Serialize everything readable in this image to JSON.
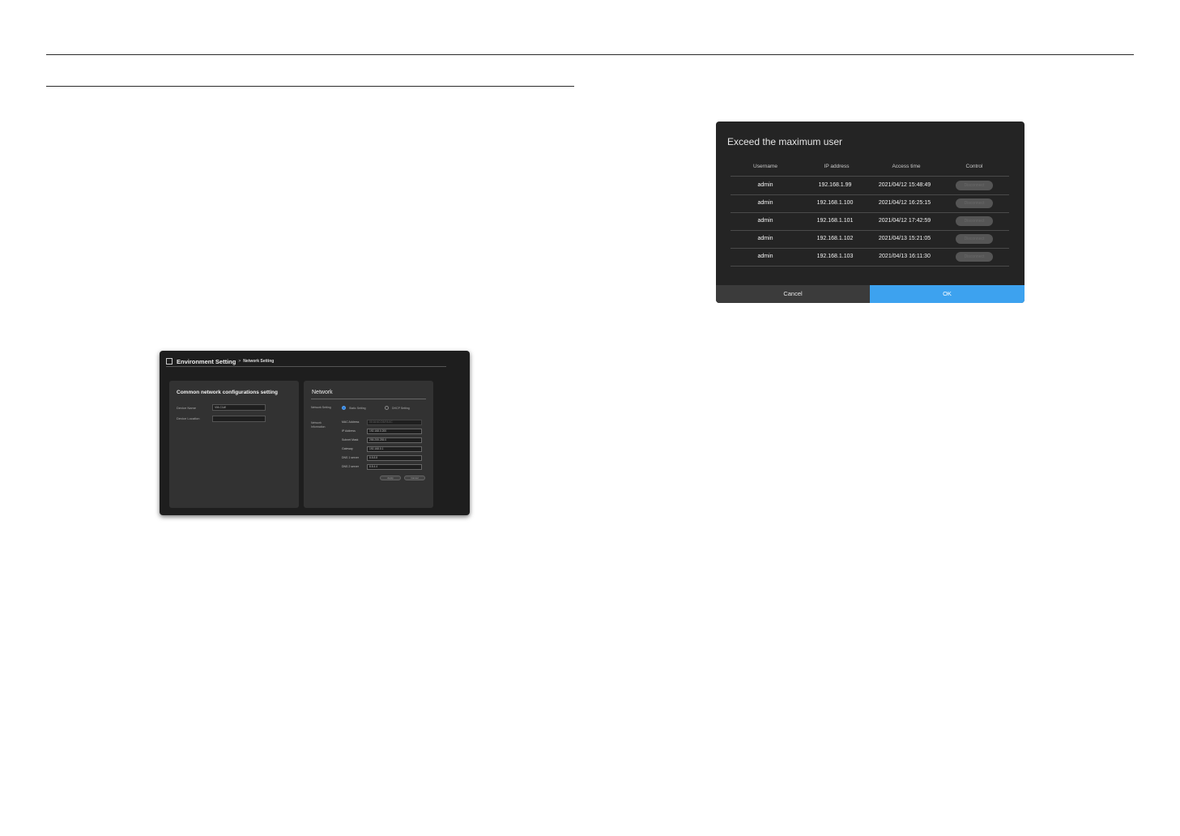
{
  "network_screenshot": {
    "title": "Environment Setting",
    "separator": ">",
    "subtitle": "Network Setting",
    "common": {
      "title": "Common network configurations setting",
      "device_name_label": "Device Name",
      "device_name_value": "VM-CLW",
      "device_location_label": "Device Location",
      "device_location_value": ""
    },
    "network": {
      "title": "Network",
      "network_setting_label": "Network Setting",
      "static_label": "Static Setting",
      "dhcp_label": "DHCP Setting",
      "network_info_label": "Network Information",
      "fields": [
        {
          "label": "MAC Address",
          "value": "00:16:6C:D5:FA:0C"
        },
        {
          "label": "IP Address",
          "value": "192.168.0.200"
        },
        {
          "label": "Subnet Mask",
          "value": "255.255.255.0"
        },
        {
          "label": "Gateway",
          "value": "192.168.0.1"
        },
        {
          "label": "DNS 1 server",
          "value": "8.8.8.8"
        },
        {
          "label": "DNS 2 server",
          "value": "8.8.4.4"
        }
      ],
      "apply_label": "Apply",
      "cancel_label": "Cancel"
    }
  },
  "dialog": {
    "title": "Exceed the maximum user",
    "columns": [
      "Username",
      "IP address",
      "Access time",
      "Control"
    ],
    "rows": [
      {
        "username": "admin",
        "ip": "192.168.1.99",
        "time": "2021/04/12 15:48:49",
        "control": "Disconnect"
      },
      {
        "username": "admin",
        "ip": "192.168.1.100",
        "time": "2021/04/12 16:25:15",
        "control": "Disconnect"
      },
      {
        "username": "admin",
        "ip": "192.168.1.101",
        "time": "2021/04/12 17:42:59",
        "control": "Disconnect"
      },
      {
        "username": "admin",
        "ip": "192.168.1.102",
        "time": "2021/04/13 15:21:05",
        "control": "Disconnect"
      },
      {
        "username": "admin",
        "ip": "192.168.1.103",
        "time": "2021/04/13 16:11:30",
        "control": "Disconnect"
      }
    ],
    "cancel_label": "Cancel",
    "ok_label": "OK",
    "ok_color": "#3da2ef"
  }
}
